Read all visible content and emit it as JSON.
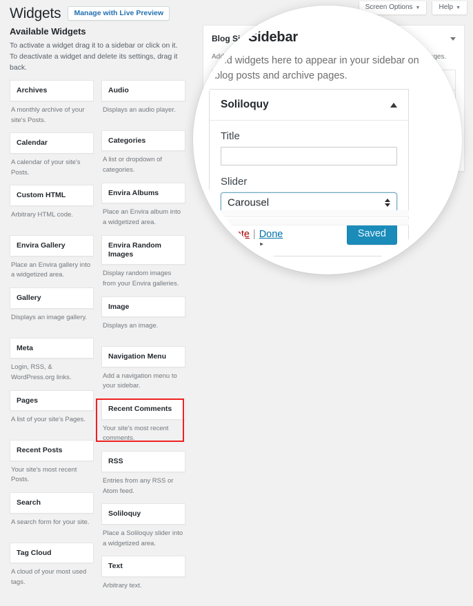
{
  "screen_meta": {
    "screen_options_label": "Screen Options",
    "help_label": "Help",
    "caret_glyph": "▼"
  },
  "header": {
    "page_title": "Widgets",
    "live_preview_label": "Manage with Live Preview"
  },
  "available_widgets": {
    "title": "Available Widgets",
    "description": "To activate a widget drag it to a sidebar or click on it. To deactivate a widget and delete its settings, drag it back.",
    "left_column": [
      {
        "name": "Archives",
        "description": "A monthly archive of your site's Posts."
      },
      {
        "name": "Calendar",
        "description": "A calendar of your site's Posts."
      },
      {
        "name": "Custom HTML",
        "description": "Arbitrary HTML code."
      },
      {
        "name": "Envira Gallery",
        "description": "Place an Envira gallery into a widgetized area."
      },
      {
        "name": "Gallery",
        "description": "Displays an image gallery."
      },
      {
        "name": "Meta",
        "description": "Login, RSS, & WordPress.org links."
      },
      {
        "name": "Pages",
        "description": "A list of your site's Pages."
      },
      {
        "name": "Recent Posts",
        "description": "Your site's most recent Posts."
      },
      {
        "name": "Search",
        "description": "A search form for your site."
      },
      {
        "name": "Tag Cloud",
        "description": "A cloud of your most used tags."
      }
    ],
    "right_column": [
      {
        "name": "Audio",
        "description": "Displays an audio player."
      },
      {
        "name": "Categories",
        "description": "A list or dropdown of categories."
      },
      {
        "name": "Envira Albums",
        "description": "Place an Envira album into a widgetized area."
      },
      {
        "name": "Envira Random Images",
        "description": "Display random images from your Envira galleries."
      },
      {
        "name": "Image",
        "description": "Displays an image."
      },
      {
        "name": "Navigation Menu",
        "description": "Add a navigation menu to your sidebar."
      },
      {
        "name": "Recent Comments",
        "description": "Your site's most recent comments."
      },
      {
        "name": "RSS",
        "description": "Entries from any RSS or Atom feed."
      },
      {
        "name": "Soliloquy",
        "description": "Place a Soliloquy slider into a widgetized area."
      },
      {
        "name": "Text",
        "description": "Arbitrary text."
      }
    ],
    "highlight_color": "#ee2020",
    "highlighted_widget": "Soliloquy"
  },
  "sidebar_panel": {
    "title": "Blog Sidebar",
    "description": "Add widgets here to appear in your sidebar on blog posts and archive pages."
  },
  "soliloquy_widget": {
    "title": "Soliloquy",
    "title_field_label": "Title",
    "title_field_value": "",
    "slider_field_label": "Slider",
    "slider_selected": "Carousel",
    "delete_label": "Delete",
    "links_separator": "|",
    "done_label": "Done",
    "saved_button_label": "Saved",
    "saved_button_color": "#1b8cba",
    "delete_link_color": "#a00",
    "done_link_color": "#0073aa"
  }
}
